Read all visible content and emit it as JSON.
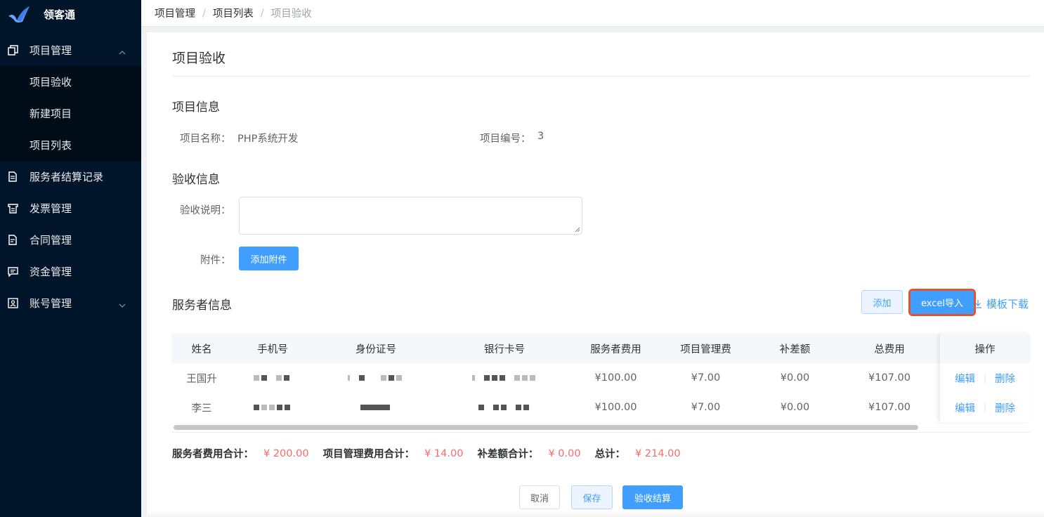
{
  "app": {
    "name": "领客通"
  },
  "colors": {
    "sidebar_bg": "#001529",
    "submenu_bg": "#000c17",
    "accent": "#409eff",
    "money": "#f56c6c",
    "highlight_outline": "#e0532e"
  },
  "sidebar": {
    "groups": [
      {
        "label": "项目管理",
        "icon": "copy-icon",
        "expanded": true,
        "children": [
          {
            "label": "项目验收"
          },
          {
            "label": "新建项目"
          },
          {
            "label": "项目列表"
          }
        ]
      },
      {
        "label": "服务者结算记录",
        "icon": "document-icon"
      },
      {
        "label": "发票管理",
        "icon": "invoice-icon"
      },
      {
        "label": "合同管理",
        "icon": "contract-icon"
      },
      {
        "label": "资金管理",
        "icon": "message-icon"
      },
      {
        "label": "账号管理",
        "icon": "account-icon",
        "expanded": false
      }
    ]
  },
  "breadcrumb": [
    "项目管理",
    "项目列表",
    "项目验收"
  ],
  "page": {
    "title": "项目验收"
  },
  "project_info": {
    "title": "项目信息",
    "name_label": "项目名称：",
    "name_value": "PHP系统开发",
    "number_label": "项目编号：",
    "number_value": "3"
  },
  "acceptance_info": {
    "title": "验收信息",
    "desc_label": "验收说明：",
    "desc_value": "",
    "attachment_label": "附件：",
    "attachment_button": "添加附件"
  },
  "provider_info": {
    "title": "服务者信息",
    "add_button": "添加",
    "import_button": "excel导入",
    "template_link": "模板下载"
  },
  "table": {
    "headers": [
      "姓名",
      "手机号",
      "身份证号",
      "银行卡号",
      "服务者费用",
      "项目管理费",
      "补差额",
      "总费用",
      "操作"
    ],
    "rows": [
      {
        "name": "王国升",
        "fee": "¥100.00",
        "mgmt": "¥7.00",
        "diff": "¥0.00",
        "total": "¥107.00",
        "edit": "编辑",
        "delete": "删除"
      },
      {
        "name": "李三",
        "fee": "¥100.00",
        "mgmt": "¥7.00",
        "diff": "¥0.00",
        "total": "¥107.00",
        "edit": "编辑",
        "delete": "删除"
      }
    ]
  },
  "summary": {
    "fee_label": "服务者费用合计：",
    "fee_value": "¥ 200.00",
    "mgmt_label": "项目管理费用合计：",
    "mgmt_value": "¥ 14.00",
    "diff_label": "补差额合计：",
    "diff_value": "¥ 0.00",
    "total_label": "总计：",
    "total_value": "¥ 214.00"
  },
  "footer": {
    "cancel": "取消",
    "save": "保存",
    "settle": "验收结算"
  }
}
